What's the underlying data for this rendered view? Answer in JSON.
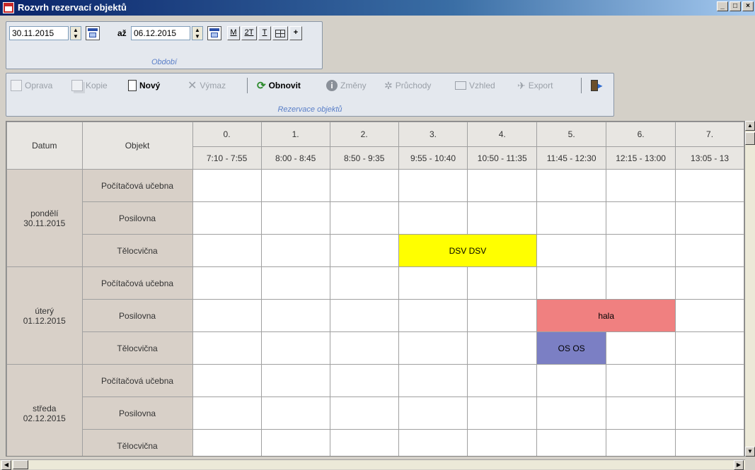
{
  "window": {
    "title": "Rozvrh rezervací objektů",
    "buttons": [
      "_",
      "□",
      "×"
    ]
  },
  "period": {
    "from": "30.11.2015",
    "to_label": "až",
    "to": "06.12.2015",
    "buttons": [
      "M",
      "2T",
      "T",
      "+"
    ],
    "caption": "Období"
  },
  "reservations_toolbar": {
    "oprava": "Oprava",
    "kopie": "Kopie",
    "novy": "Nový",
    "vymaz": "Výmaz",
    "obnovit": "Obnovit",
    "zmeny": "Změny",
    "pruchody": "Průchody",
    "vzhled": "Vzhled",
    "export": "Export",
    "caption": "Rezervace objektů"
  },
  "grid": {
    "col_datum": "Datum",
    "col_objekt": "Objekt",
    "periods": [
      {
        "num": "0.",
        "time": "7:10 - 7:55"
      },
      {
        "num": "1.",
        "time": "8:00 - 8:45"
      },
      {
        "num": "2.",
        "time": "8:50 - 9:35"
      },
      {
        "num": "3.",
        "time": "9:55 - 10:40"
      },
      {
        "num": "4.",
        "time": "10:50 - 11:35"
      },
      {
        "num": "5.",
        "time": "11:45 - 12:30"
      },
      {
        "num": "6.",
        "time": "12:15 - 13:00"
      },
      {
        "num": "7.",
        "time": "13:05 - 13"
      }
    ],
    "days": [
      {
        "day": "pondělí",
        "date": "30.11.2015",
        "objects": [
          {
            "name": "Počítačová učebna",
            "reservations": []
          },
          {
            "name": "Posilovna",
            "reservations": []
          },
          {
            "name": "Tělocvična",
            "reservations": [
              {
                "start": 3,
                "span": 2,
                "label": "DSV DSV",
                "color": "#ffff00"
              }
            ]
          }
        ]
      },
      {
        "day": "úterý",
        "date": "01.12.2015",
        "objects": [
          {
            "name": "Počítačová učebna",
            "reservations": []
          },
          {
            "name": "Posilovna",
            "reservations": [
              {
                "start": 5,
                "span": 2,
                "label": "hala",
                "color": "#f08080"
              }
            ]
          },
          {
            "name": "Tělocvična",
            "reservations": [
              {
                "start": 5,
                "span": 1,
                "label": "OS OS",
                "color": "#7b7fc4"
              }
            ]
          }
        ]
      },
      {
        "day": "středa",
        "date": "02.12.2015",
        "objects": [
          {
            "name": "Počítačová učebna",
            "reservations": []
          },
          {
            "name": "Posilovna",
            "reservations": []
          },
          {
            "name": "Tělocvična",
            "reservations": []
          }
        ]
      }
    ]
  }
}
